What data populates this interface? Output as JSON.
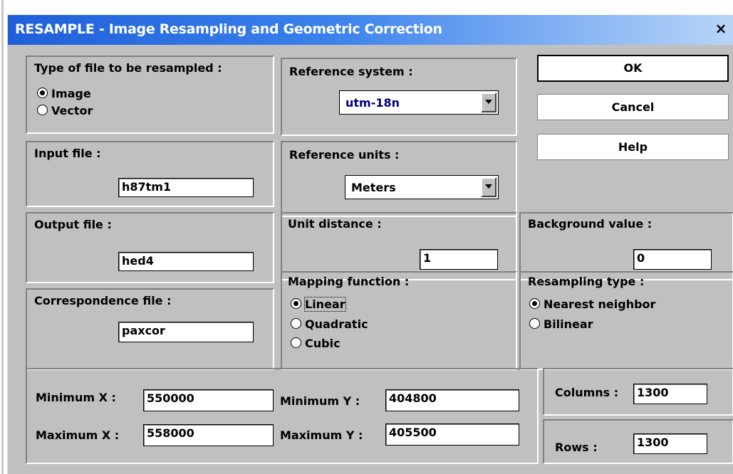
{
  "window": {
    "title": "RESAMPLE - Image Resampling and Geometric Correction",
    "close_label": "×"
  },
  "file_type": {
    "label": "Type of file to be resampled :",
    "options": [
      {
        "label": "Image",
        "selected": true
      },
      {
        "label": "Vector",
        "selected": false
      }
    ]
  },
  "input_file": {
    "label": "Input file :",
    "value": "h87tm1"
  },
  "output_file": {
    "label": "Output file :",
    "value": "hed4"
  },
  "correspondence_file": {
    "label": "Correspondence file :",
    "value": "paxcor"
  },
  "reference_system": {
    "label": "Reference system :",
    "value": "utm-18n",
    "color": "#000080"
  },
  "reference_units": {
    "label": "Reference units :",
    "value": "Meters"
  },
  "unit_distance": {
    "label": "Unit distance :",
    "value": "1"
  },
  "mapping_function": {
    "label": "Mapping function :",
    "options": [
      {
        "label": "Linear",
        "selected": true
      },
      {
        "label": "Quadratic",
        "selected": false
      },
      {
        "label": "Cubic",
        "selected": false
      }
    ]
  },
  "background_value": {
    "label": "Background value :",
    "value": "0"
  },
  "resampling_type": {
    "label": "Resampling type :",
    "options": [
      {
        "label": "Nearest neighbor",
        "selected": true
      },
      {
        "label": "Bilinear",
        "selected": false
      }
    ]
  },
  "buttons": {
    "ok": "OK",
    "cancel": "Cancel",
    "help": "Help"
  },
  "bounds": {
    "min_x_label": "Minimum X :",
    "min_x": "550000",
    "max_x_label": "Maximum X :",
    "max_x": "558000",
    "min_y_label": "Minimum Y :",
    "min_y": "404800",
    "max_y_label": "Maximum Y :",
    "max_y": "405500"
  },
  "columns": {
    "label": "Columns :",
    "value": "1300"
  },
  "rows": {
    "label": "Rows :",
    "value": "1300"
  }
}
